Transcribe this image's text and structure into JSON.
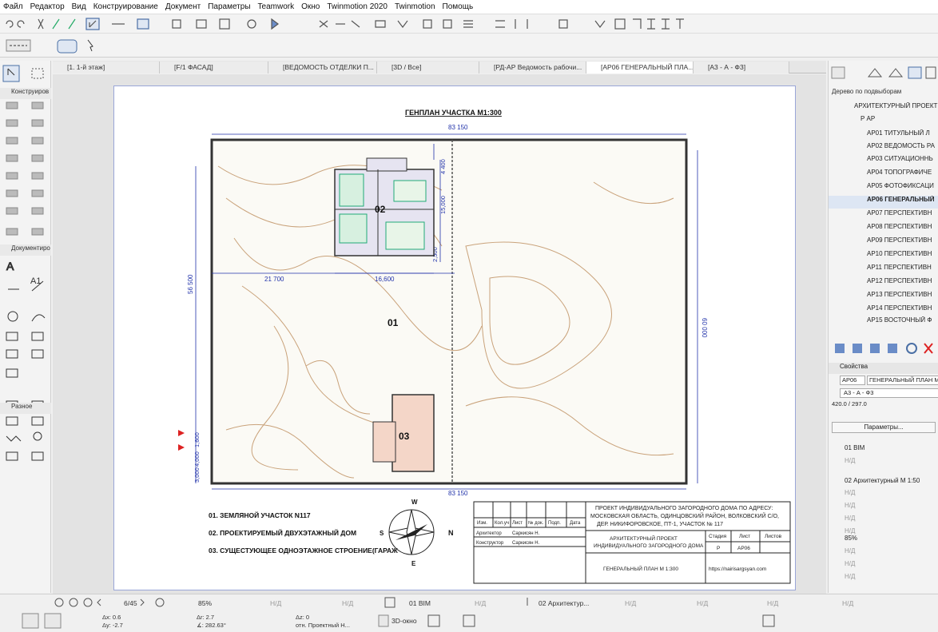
{
  "menu": [
    "Файл",
    "Редактор",
    "Вид",
    "Конструирование",
    "Документ",
    "Параметры",
    "Teamwork",
    "Окно",
    "Twinmotion 2020",
    "Twinmotion",
    "Помощь"
  ],
  "left_panel": {
    "sections": [
      "Конструиров",
      "Документиро",
      "Разное"
    ],
    "text_tool_a1": "A1"
  },
  "tabs": [
    {
      "label": "[1. 1-й этаж]"
    },
    {
      "label": "[F/1 ФАСАД]"
    },
    {
      "label": "[ВЕДОМОСТЬ ОТДЕЛКИ П..."
    },
    {
      "label": "[3D / Все]"
    },
    {
      "label": "[РД-АР Ведомость рабочи..."
    },
    {
      "label": "[АР06 ГЕНЕРАЛЬНЫЙ ПЛА..."
    },
    {
      "label": "[А3 - А - Ф3]"
    }
  ],
  "drawing": {
    "title": "ГЕНПЛАН УЧАСТКА М1:300",
    "dims": {
      "top": "83 150",
      "bottom": "83 150",
      "d4400": "4 400",
      "d15000": "15,000",
      "d2500": "2,500",
      "d21700": "21 700",
      "d16600": "16,600",
      "d56500": "56 500",
      "d60000": "60 000",
      "d1600": "1,600",
      "d4000": "4,000",
      "d3000": "3,000"
    },
    "labels": {
      "lot": "01",
      "house": "02",
      "garage": "03"
    },
    "legend": [
      "01.  ЗЕМЛЯНОЙ УЧАСТОК N117",
      "02.  ПРОЕКТИРУЕМЫЙ ДВУХЭТАЖНЫЙ ДОМ",
      "03.  СУЩЕСТУЮЩЕЕ ОДНОЭТАЖНОЕ СТРОЕНИЕ(ГАРАЖ"
    ],
    "compass": {
      "n": "N",
      "s": "S",
      "e": "E",
      "w": "W"
    },
    "titleblock": {
      "project": "ПРОЕКТ ИНДИВИДУАЛЬНОГО ЗАГОРОДНОГО ДОМА ПО АДРЕСУ:",
      "address1": "МОСКОВСКАЯ ОБЛАСТЬ, ОДИНЦОВСКИЙ РАЙОН, ВОЛКОВСКИЙ С/О,",
      "address2": "ДЕР. НИКИФОРОВСКОЕ, ПТ-1, УЧАСТОК № 117",
      "cols": [
        "Изм.",
        "Кол.уч",
        "Лист",
        "№ док.",
        "Подп.",
        "Дата"
      ],
      "architect_label": "Архитектор",
      "architect_name": "Саркисян Н.",
      "constructor_label": "Конструктор",
      "constructor_name": "Саркисян Н.",
      "subject1": "АРХИТЕКТУРНЫЙ ПРОЕКТ",
      "subject2": "ИНДИВИДУАЛЬНОГО ЗАГОРОДНОГО ДОМА",
      "stage_label": "Стадия",
      "sheet_label": "Лист",
      "sheets_label": "Листов",
      "stage": "Р",
      "sheet": "АР06",
      "sheet_title": "ГЕНЕРАЛЬНЫЙ ПЛАН М 1:300",
      "site": "https://nairisargsyan.com"
    }
  },
  "right_panel": {
    "tree_header": "Дерево по подвыборам",
    "tree": [
      "АРХИТЕКТУРНЫЙ ПРОЕКТ",
      "Р АР",
      "АР01 ТИТУЛЬНЫЙ Л",
      "АР02 ВЕДОМОСТЬ РА",
      "АР03 СИТУАЦИОННЬ",
      "АР04 ТОПОГРАФИЧЕ",
      "АР05 ФОТОФИКСАЦИ",
      "АР06 ГЕНЕРАЛЬНЫЙ",
      "АР07 ПЕРСПЕКТИВН",
      "АР08 ПЕРСПЕКТИВН",
      "АР09 ПЕРСПЕКТИВН",
      "АР10 ПЕРСПЕКТИВН",
      "АР11 ПЕРСПЕКТИВН",
      "АР12 ПЕРСПЕКТИВН",
      "АР13 ПЕРСПЕКТИВН",
      "АР14 ПЕРСПЕКТИВН",
      "АР15 ВОСТОЧНЫЙ Ф"
    ],
    "props_header": "Свойства",
    "prop_id": "АР06",
    "prop_name": "ГЕНЕРАЛЬНЫЙ ПЛАН М",
    "prop_layout": "А3 - А - Ф3",
    "prop_size": "420.0 / 297.0",
    "params_button": "Параметры...",
    "rows": [
      "01 BIM",
      "Н/Д",
      "02 Архитектурный М 1:50",
      "Н/Д",
      "Н/Д",
      "Н/Д",
      "Н/Д",
      "85%",
      "Н/Д",
      "Н/Д",
      "Н/Д"
    ]
  },
  "status": {
    "page": "6/45",
    "zoom": "85%",
    "nd1": "Н/Д",
    "nd2": "Н/Д",
    "nd3": "Н/Д",
    "layer": "01 BIM",
    "nd4": "Н/Д",
    "view": "02 Архитектур...",
    "nd5": "Н/Д",
    "nd6": "Н/Д",
    "nd7": "Н/Д",
    "dx": "Δx: 0.6",
    "dy": "Δy: -2.7",
    "dr": "Δr: 2.7",
    "ang": "∡: 282.63°",
    "dz": "Δz: 0",
    "ref": "отн. Проектный Н...",
    "view3d": "3D-окно"
  }
}
